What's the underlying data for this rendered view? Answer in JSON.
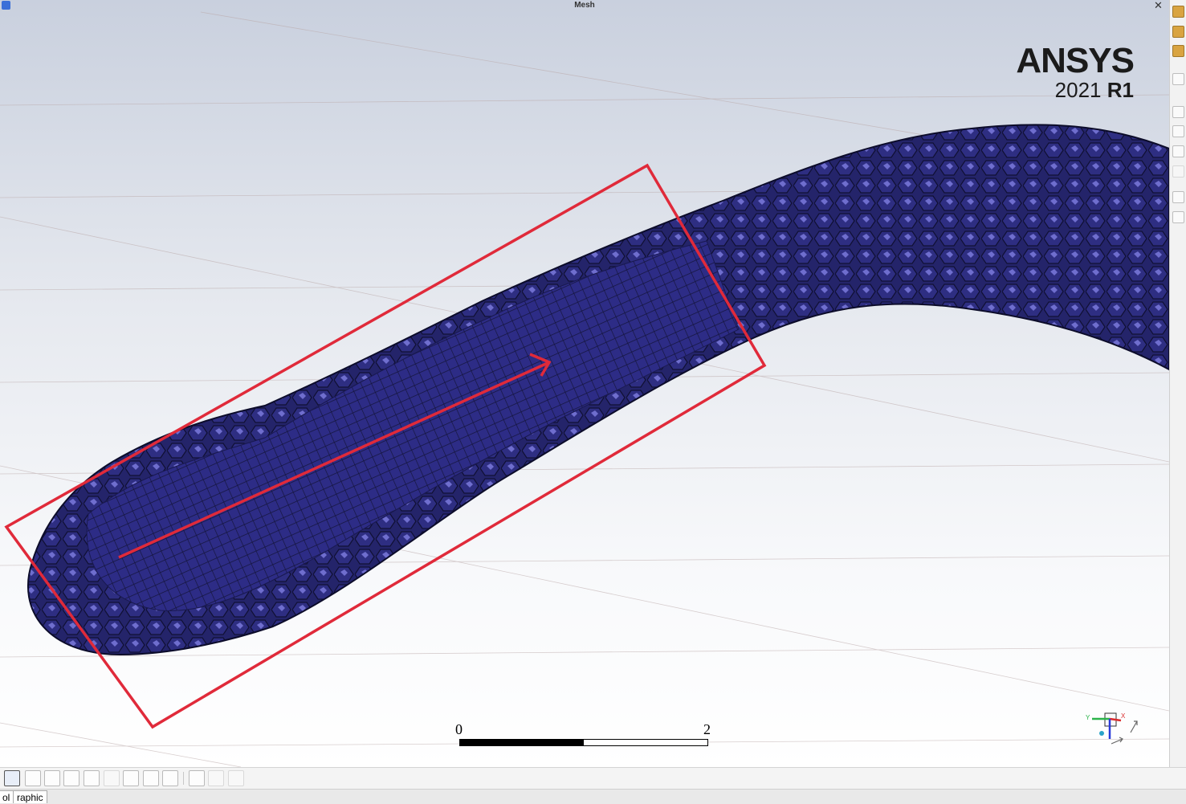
{
  "window": {
    "title": "Mesh",
    "close_glyph": "✕"
  },
  "brand": {
    "name": "ANSYS",
    "year": "2021",
    "release": "R1"
  },
  "scale_bar": {
    "start_label": "0",
    "end_label": "2",
    "filled_fraction": 0.5
  },
  "mesh": {
    "color": "#2a2a78",
    "highlight_color": "#7b7ae0",
    "annotation_color": "#e02a3a"
  },
  "triad": {
    "y_label": "Y",
    "x_label": "X"
  },
  "right_toolbar": {
    "icons": [
      "shade-icon",
      "surface-icon",
      "pan-icon",
      "rotate-icon",
      "axes-icon",
      "ruler-icon",
      "notes-icon",
      "report-icon",
      "copy-icon",
      "snapshot-icon"
    ]
  },
  "bottom_toolbar": {
    "icons": [
      "select-point-icon",
      "select-edge-icon",
      "select-face-icon",
      "select-zone-icon",
      "select-cell-icon",
      "select-multi-icon",
      "select-node-icon",
      "select-line-icon",
      "select-box-icon",
      "filter-icon",
      "cell-select-icon",
      "lasso-icon"
    ]
  },
  "tabs": [
    {
      "label": "ol"
    },
    {
      "label": "raphic"
    }
  ]
}
